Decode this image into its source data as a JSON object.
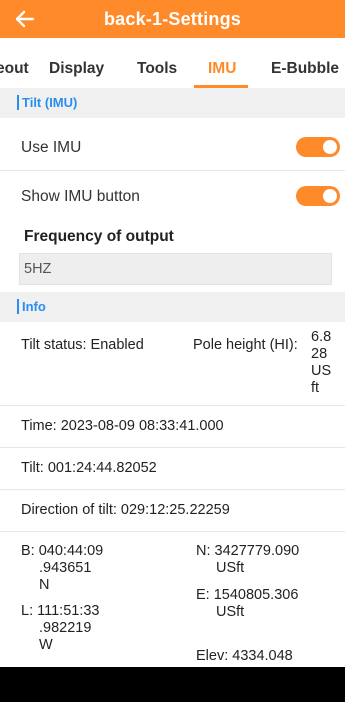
{
  "header": {
    "title": "back-1-Settings",
    "back_icon": "back-arrow-icon",
    "background": "#ff8a2a"
  },
  "tabs": [
    {
      "label": "eout"
    },
    {
      "label": "Display"
    },
    {
      "label": "Tools"
    },
    {
      "label": "IMU",
      "active": true
    },
    {
      "label": "E-Bubble"
    }
  ],
  "tilt_section": {
    "title": "Tilt (IMU)",
    "use_imu": {
      "label": "Use IMU",
      "enabled": true
    },
    "show_imu_button": {
      "label": "Show IMU button",
      "enabled": true
    },
    "frequency": {
      "label": "Frequency of output",
      "value": "5HZ"
    }
  },
  "info_section": {
    "title": "Info",
    "tilt_status": "Tilt status: Enabled",
    "pole_height_label": "Pole height (HI):",
    "pole_height_lines": [
      "6.8",
      "28",
      "US",
      "ft"
    ],
    "time": "Time: 2023-08-09 08:33:41.000",
    "tilt": "Tilt: 001:24:44.82052",
    "direction_of_tilt": "Direction of tilt: 029:12:25.22259",
    "b_lines": [
      "B: 040:44:09",
      ".943651",
      "N"
    ],
    "l_lines": [
      "L: 111:51:33",
      ".982219",
      "W"
    ],
    "n_lines": [
      "N: 3427779.090",
      "USft"
    ],
    "e_lines": [
      "E: 1540805.306",
      "USft"
    ],
    "elev_lines": [
      "Elev: 4334.048"
    ]
  },
  "colors": {
    "accent": "#ff8a2a",
    "section_title": "#2a8ef0",
    "section_bg": "#f0f0f0"
  }
}
